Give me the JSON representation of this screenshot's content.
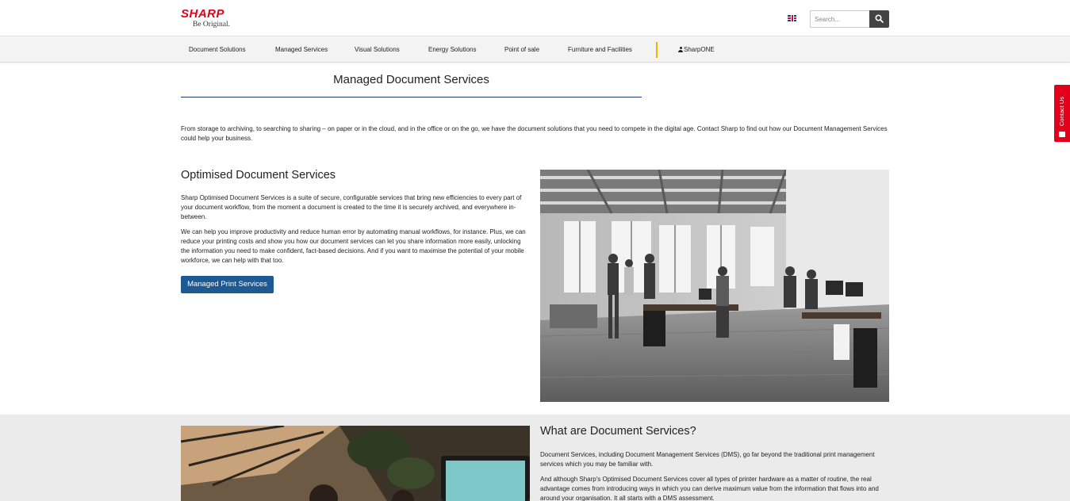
{
  "header": {
    "logo_text": "SHARP",
    "logo_tagline": "Be Original.",
    "language_icon": "uk-flag-icon",
    "search": {
      "placeholder": "Search...",
      "button_icon": "search-icon"
    }
  },
  "nav": {
    "items": [
      {
        "label": "Document Solutions"
      },
      {
        "label": "Managed Services"
      },
      {
        "label": "Visual Solutions"
      },
      {
        "label": "Energy Solutions"
      },
      {
        "label": "Point of sale"
      },
      {
        "label": "Furniture and Facilities"
      }
    ],
    "account": {
      "label": "SharpONE",
      "icon": "user-icon"
    }
  },
  "main": {
    "page_title": "Managed Document Services",
    "intro": "From storage to archiving, to searching to sharing – on paper or in the cloud, and in the office or on the go, we have the document solutions that you need to compete in the digital age. Contact Sharp to find out how our Document Management Services could help your business.",
    "section1": {
      "title": "Optimised Document Services",
      "para1": "Sharp Optimised Document Services is a suite of secure, configurable services that bring new efficiencies to every part of your document workflow, from the moment a document is created to the time it is securely archived, and everywhere in-between.",
      "para2": "We can help you improve productivity and reduce human error by automating manual workflows, for instance. Plus, we can reduce your printing costs and show you how our document services can let you share information more easily, unlocking the information you need to make confident, fact-based decisions. And if you want to maximise the potential of your mobile workforce, we can help with that too.",
      "button_label": "Managed Print Services"
    },
    "section2": {
      "title": "What are Document Services?",
      "para1": "Document Services, including Document Management Services (DMS), go far beyond the traditional print management services which you may be familiar with.",
      "para2": "And although Sharp's Optimised Document Services cover all types of printer hardware as a matter of routine, the real advantage comes from introducing ways in which you can derive maximum value from the information that flows into and around your organisation. It all starts with a DMS assessment."
    }
  },
  "contact_tab": {
    "label": "Contact Us",
    "icon": "mail-icon"
  },
  "colors": {
    "brand_red": "#e2001a",
    "button_blue": "#1d5a94",
    "nav_divider": "#f0b400"
  }
}
